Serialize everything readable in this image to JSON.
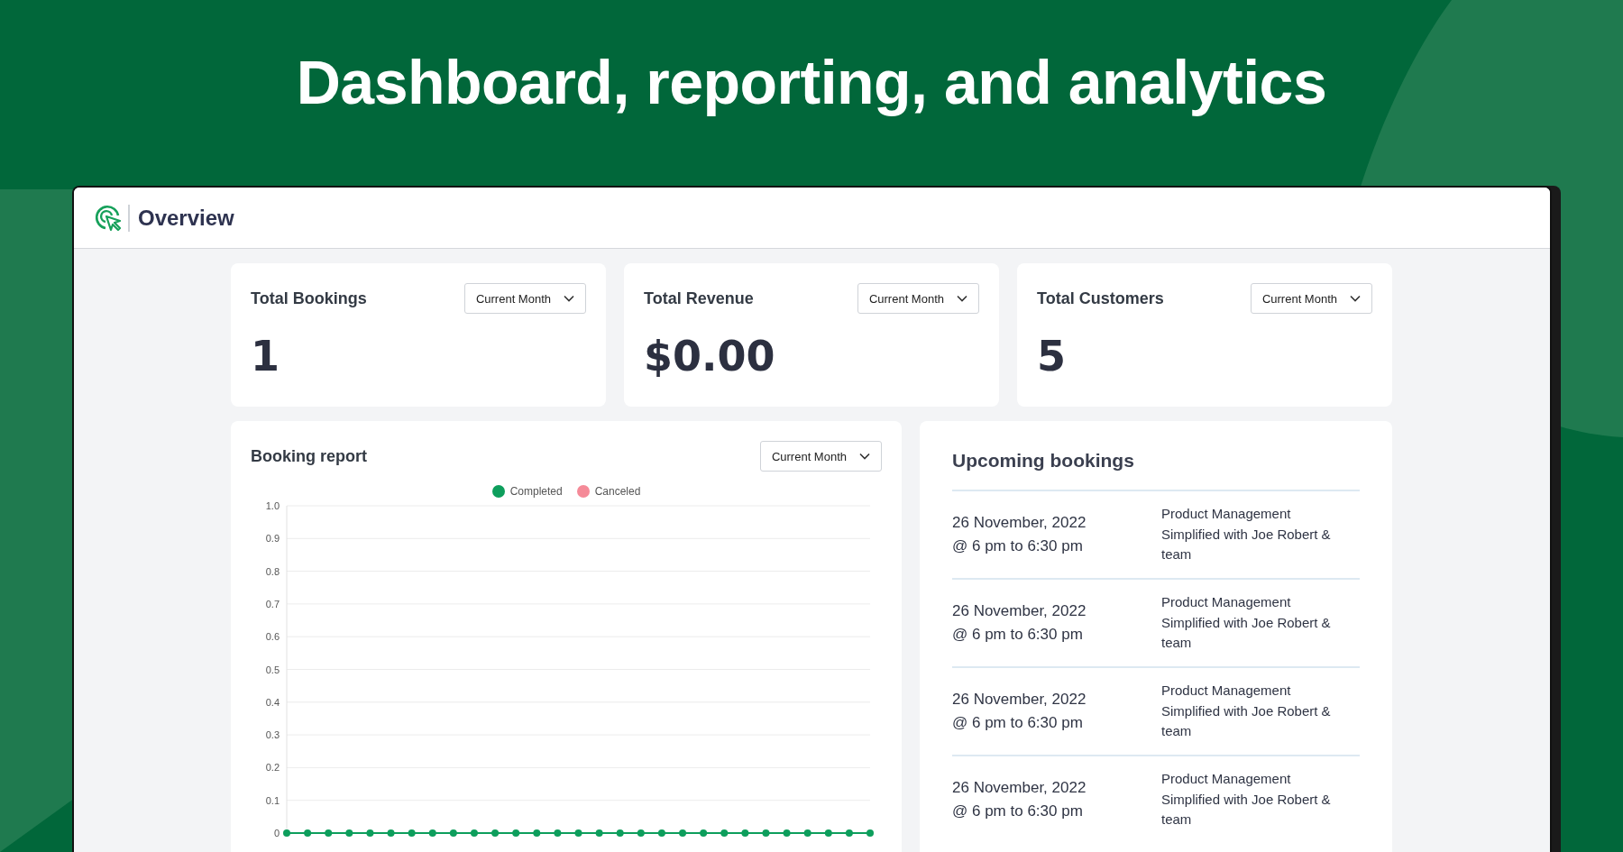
{
  "headline": "Dashboard, reporting, and analytics",
  "window": {
    "title": "Overview"
  },
  "stats": [
    {
      "label": "Total Bookings",
      "period": "Current Month",
      "value": "1"
    },
    {
      "label": "Total Revenue",
      "period": "Current Month",
      "value": "$0.00"
    },
    {
      "label": "Total Customers",
      "period": "Current Month",
      "value": "5"
    }
  ],
  "booking_report": {
    "title": "Booking report",
    "period": "Current Month",
    "legend": [
      {
        "name": "Canceled",
        "color": "#f58a98"
      }
    ],
    "chart_data": {
      "type": "line",
      "grid": true,
      "ylim": [
        0,
        1
      ],
      "yticks": [
        {
          "value": 0,
          "label": "0"
        },
        {
          "value": 0.1,
          "label": "0.1"
        },
        {
          "value": 0.2,
          "label": "0.2"
        },
        {
          "value": 0.3,
          "label": "0.3"
        },
        {
          "value": 0.4,
          "label": "0.4"
        },
        {
          "value": 0.5,
          "label": "0.5"
        },
        {
          "value": 0.6,
          "label": "0.6"
        },
        {
          "value": 0.7,
          "label": "0.7"
        },
        {
          "value": 0.8,
          "label": "0.8"
        },
        {
          "value": 0.9,
          "label": "0.9"
        },
        {
          "value": 1,
          "label": "1.0"
        }
      ],
      "series": [
        {
          "name": "Completed",
          "color": "#0d9e5c",
          "marker": true,
          "values": [
            0,
            0,
            0,
            0,
            0,
            0,
            0,
            0,
            0,
            0,
            0,
            0,
            0,
            0,
            0,
            0,
            0,
            0,
            0,
            0,
            0,
            0,
            0,
            0,
            0,
            0,
            0,
            0,
            0
          ]
        }
      ]
    }
  },
  "upcoming": {
    "title": "Upcoming bookings",
    "bookings": [
      {
        "date": "26 November, 2022",
        "time": "@ 6 pm to 6:30 pm",
        "event": "Product Management Simplified with Joe Robert & team"
      },
      {
        "date": "26 November, 2022",
        "time": "@ 6 pm to 6:30 pm",
        "event": "Product Management Simplified with Joe Robert & team"
      },
      {
        "date": "26 November, 2022",
        "time": "@ 6 pm to 6:30 pm",
        "event": "Product Management Simplified with Joe Robert & team"
      },
      {
        "date": "26 November, 2022",
        "time": "@ 6 pm to 6:30 pm",
        "event": "Product Management Simplified with Joe Robert & team"
      }
    ]
  }
}
